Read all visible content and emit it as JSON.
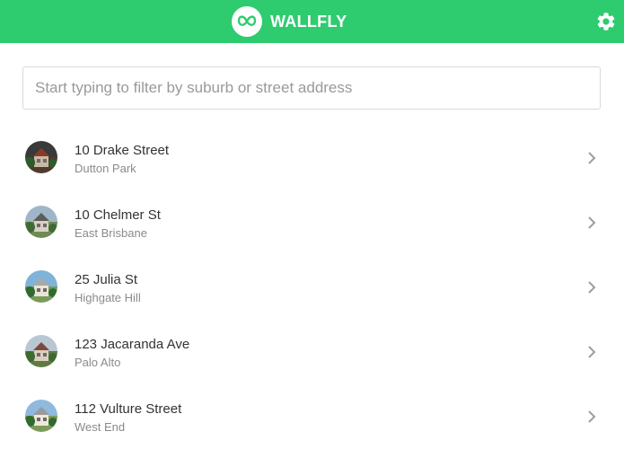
{
  "header": {
    "brand": "WALLFLY",
    "accent_color": "#2ecc6f",
    "logo_icon": "wallfly-logo-icon",
    "settings_icon": "gear-icon"
  },
  "search": {
    "placeholder": "Start typing to filter by suburb or street address",
    "value": ""
  },
  "properties": [
    {
      "street": "10 Drake Street",
      "suburb": "Dutton Park",
      "photo": "property-photo"
    },
    {
      "street": "10 Chelmer St",
      "suburb": "East Brisbane",
      "photo": "property-photo"
    },
    {
      "street": "25 Julia St",
      "suburb": "Highgate Hill",
      "photo": "property-photo"
    },
    {
      "street": "123 Jacaranda Ave",
      "suburb": "Palo Alto",
      "photo": "property-photo"
    },
    {
      "street": "112 Vulture Street",
      "suburb": "West End",
      "photo": "property-photo"
    }
  ]
}
